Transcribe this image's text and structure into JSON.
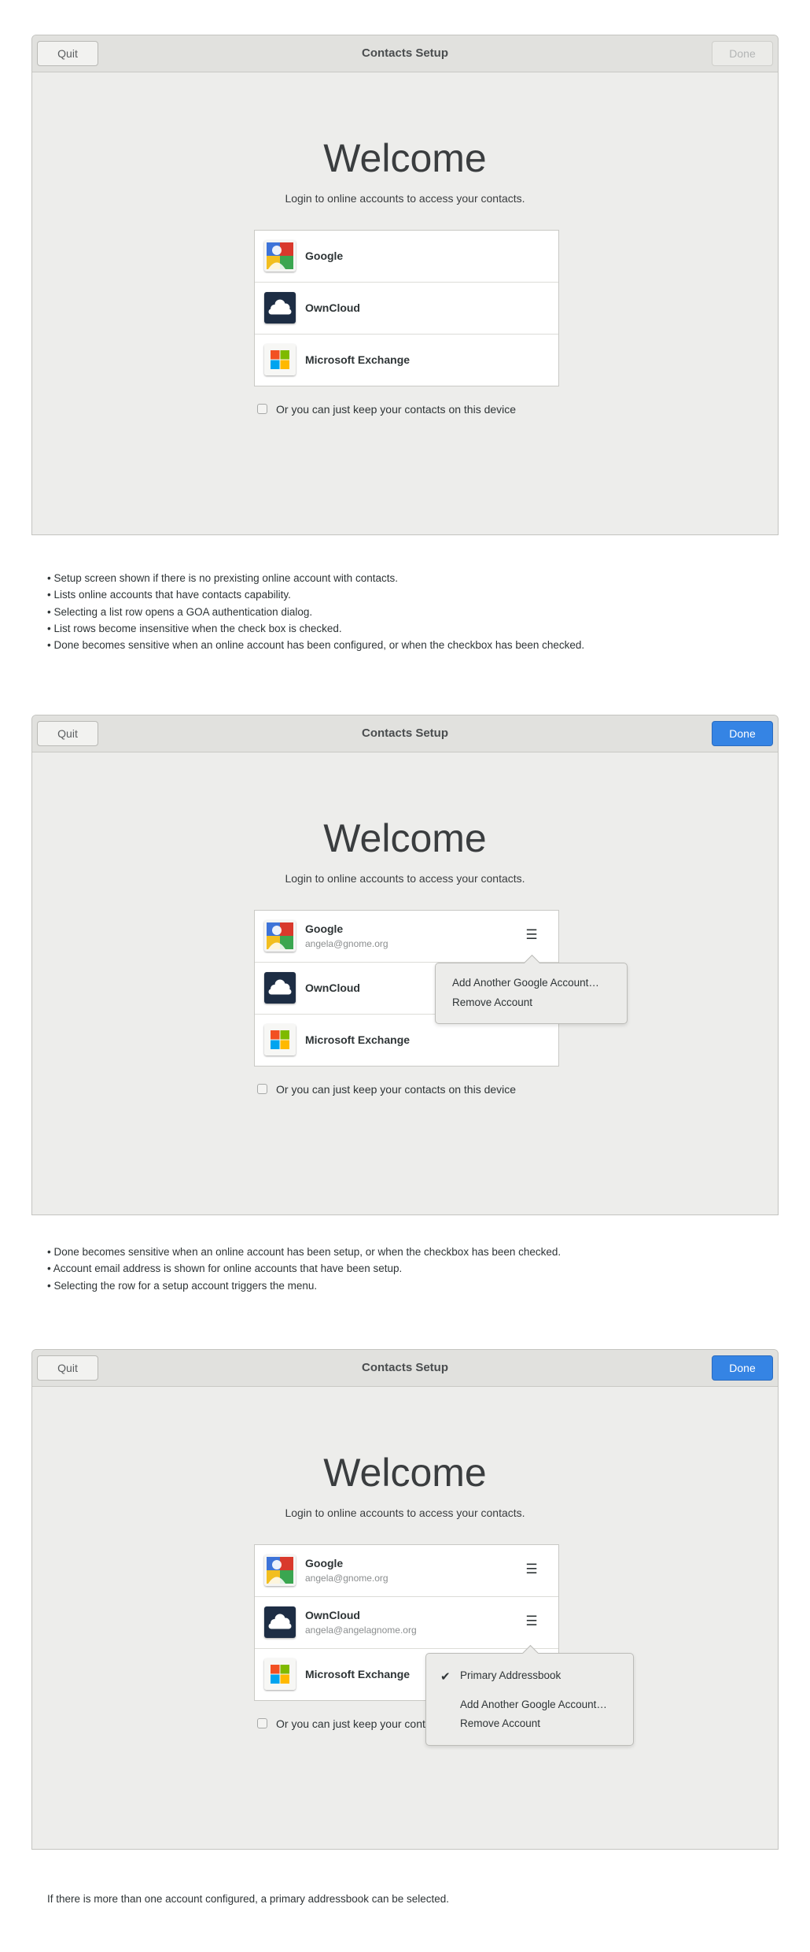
{
  "screens": [
    {
      "header": {
        "quit_label": "Quit",
        "title": "Contacts Setup",
        "done_label": "Done",
        "done_state": "disabled"
      },
      "heading": "Welcome",
      "subtitle": "Login to online accounts to access your contacts.",
      "accounts": [
        {
          "name": "Google",
          "email": ""
        },
        {
          "name": "OwnCloud",
          "email": ""
        },
        {
          "name": "Microsoft Exchange",
          "email": ""
        }
      ],
      "checkbox_label": "Or you can just keep your contacts on this device",
      "checkbox_checked": false
    },
    {
      "header": {
        "quit_label": "Quit",
        "title": "Contacts Setup",
        "done_label": "Done",
        "done_state": "active"
      },
      "heading": "Welcome",
      "subtitle": "Login to online accounts to access your contacts.",
      "accounts": [
        {
          "name": "Google",
          "email": "angela@gnome.org",
          "menu_icon": "hamburger-menu-icon"
        },
        {
          "name": "OwnCloud",
          "email": ""
        },
        {
          "name": "Microsoft Exchange",
          "email": ""
        }
      ],
      "checkbox_label": "Or you can just keep your contacts on this device",
      "checkbox_checked": false,
      "popover": {
        "items": [
          "Add Another Google Account…",
          "Remove Account"
        ]
      }
    },
    {
      "header": {
        "quit_label": "Quit",
        "title": "Contacts Setup",
        "done_label": "Done",
        "done_state": "active"
      },
      "heading": "Welcome",
      "subtitle": "Login to online accounts to access your contacts.",
      "accounts": [
        {
          "name": "Google",
          "email": "angela@gnome.org",
          "menu_icon": "hamburger-menu-icon"
        },
        {
          "name": "OwnCloud",
          "email": "angela@angelagnome.org",
          "menu_icon": "hamburger-menu-icon"
        },
        {
          "name": "Microsoft Exchange",
          "email": ""
        }
      ],
      "checkbox_label": "Or you can just keep your contacts on this device",
      "checkbox_checked": false,
      "popover": {
        "check_mark": "✔",
        "checked_item": "Primary Addressbook",
        "items": [
          "Add Another Google Account…",
          "Remove Account"
        ]
      }
    }
  ],
  "notes_1": [
    "• Setup screen shown if there is no prexisting online account with contacts.",
    "• Lists online accounts that have contacts capability.",
    "• Selecting a list row opens a GOA authentication dialog.",
    "• List rows become insensitive when the check box is checked.",
    "• Done becomes sensitive when an online account has been configured, or when the checkbox has been checked."
  ],
  "notes_2": [
    "• Done becomes sensitive when an online account has been setup, or when the checkbox has been checked.",
    "• Account email address is shown for online accounts that have been setup.",
    "• Selecting the row for a setup account triggers the menu."
  ],
  "footnote": "If there is more than one account configured, a primary addressbook can be selected.",
  "colors": {
    "accent": "#3584e4",
    "window_bg": "#ededeb",
    "headerbar_bg": "#e1e1de"
  },
  "icons": {
    "google": "google-icon",
    "owncloud": "owncloud-icon",
    "exchange": "microsoft-exchange-icon"
  }
}
